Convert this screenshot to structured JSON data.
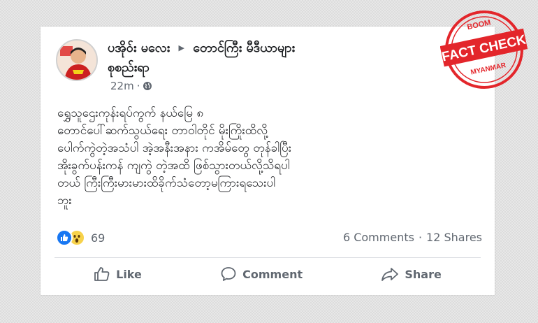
{
  "post": {
    "poster_name": "ပအိုဝ်း မလေး",
    "group_name_line1": "တောင်ကြီး မီဒီယာများ",
    "group_name_line2": "စုစည်းရာ",
    "time": "22m",
    "privacy_icon": "globe-icon",
    "body_lines": [
      "ရွှေသူဌေးကုန်းရပ်ကွက်  နယ်မြေ ၈",
      "တောင်ပေါ်ဆက်သွယ်ရေး တာဝါတိုင် မိုးကြိုးထိလို့",
      "ပေါက်ကွဲတဲ့အသံပါ အဲ့အနီးအနား ကအိမ်တွေ တုန်ခါပြီး",
      "အိုးခွက်ပန်းကန်  ကျကွဲ တဲ့အထိ ဖြစ်သွားတယ်လို့သိရပါ",
      "တယ် ကြီးကြီးမားမားထိခိုက်သံတော့မကြားရသေးပါ",
      "ဘူး"
    ],
    "reaction_count": "69",
    "comments": "6 Comments",
    "shares": "12 Shares"
  },
  "actions": {
    "like": "Like",
    "comment": "Comment",
    "share": "Share"
  },
  "stamp": {
    "top": "BOOM",
    "main": "FACT CHECK",
    "bottom": "MYANMAR",
    "color": "#e3262b"
  },
  "colors": {
    "like_blue": "#1877f2",
    "text": "#1c1e21",
    "muted": "#606770"
  }
}
